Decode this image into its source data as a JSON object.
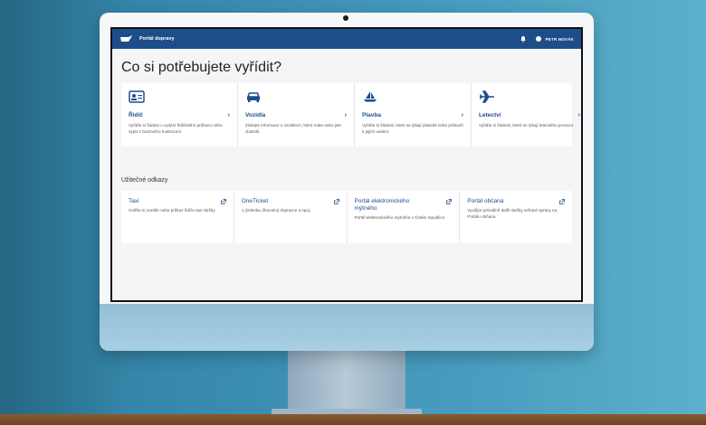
{
  "app": {
    "brand": "Portál dopravy",
    "user_name": "PETR NOVÁK"
  },
  "page": {
    "title": "Co si potřebujete vyřídit?"
  },
  "cards": [
    {
      "icon": "id-card-icon",
      "title": "Řidič",
      "desc": "Vyřiďte si žádost o vydání řidičského průkazu nebo výpis z bodového hodnocení."
    },
    {
      "icon": "car-icon",
      "title": "Vozidla",
      "desc": "Získejte informace o vozidlech, které máte nebo jste vlastnili."
    },
    {
      "icon": "sailboat-icon",
      "title": "Plavba",
      "desc": "Vyřiďte si žádosti, které se týkají plavidel nebo průkazů k jejich vedení."
    },
    {
      "icon": "airplane-icon",
      "title": "Letectví",
      "desc": "Vyřiďte si žádosti, které se týkají leteckého provozu."
    }
  ],
  "useful_links": {
    "label": "Užitečné odkazy",
    "items": [
      {
        "title": "Taxi",
        "desc": "Ověřte si vozidlo nebo průkaz řidiče taxi služby."
      },
      {
        "title": "OneTicket",
        "desc": "1 jízdenka, libovolný dopravce a spoj."
      },
      {
        "title": "Portál elektronického mýtného",
        "desc": "Portál elektronického mýtného v České republice."
      },
      {
        "title": "Portál občana",
        "desc": "Využijte pohodlně další služby veřejné správy na Portálu občana."
      }
    ]
  },
  "colors": {
    "brand_blue": "#1d4e8a",
    "wall": "#3b8db0"
  }
}
